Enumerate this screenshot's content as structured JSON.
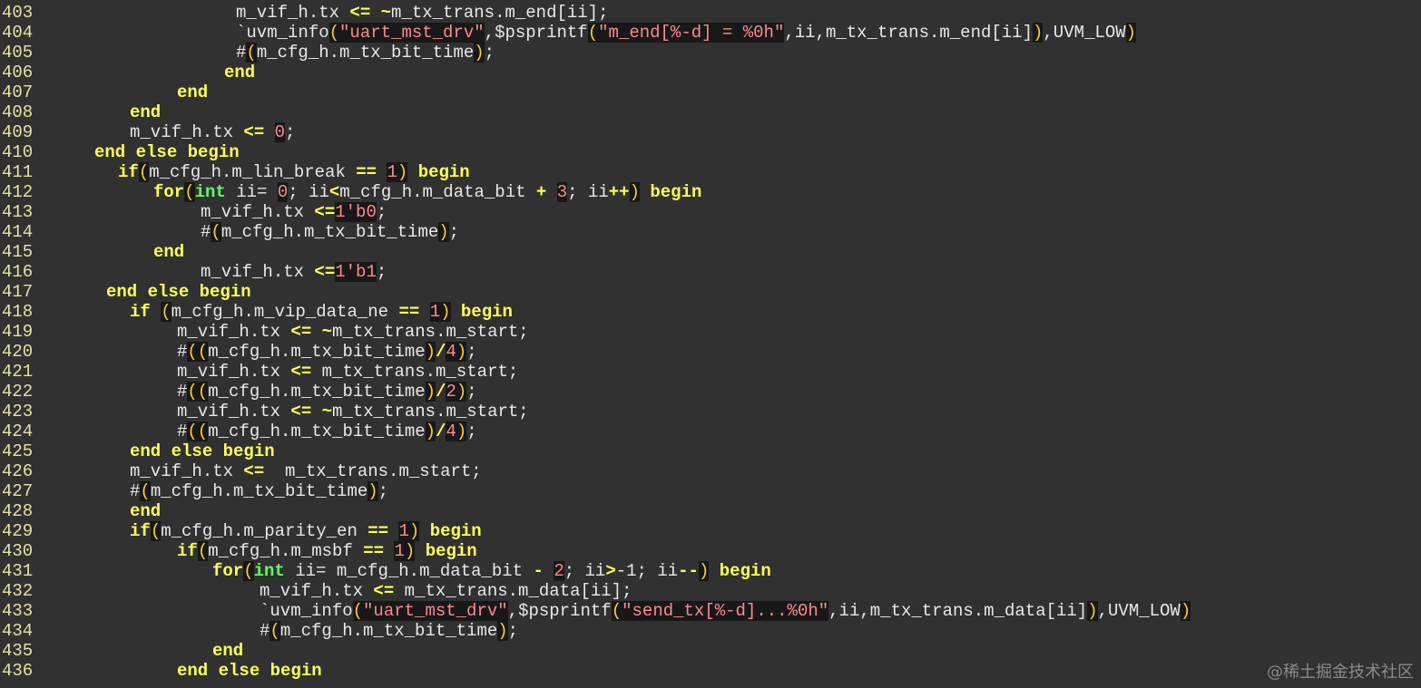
{
  "editor": {
    "lines": [
      {
        "n": "403",
        "indent": 20,
        "tokens": [
          {
            "t": "m_vif_h.tx "
          },
          {
            "t": "<=",
            "c": "opb"
          },
          {
            "t": " "
          },
          {
            "t": "~",
            "c": "opb"
          },
          {
            "t": "m_tx_trans.m_end[ii];"
          }
        ]
      },
      {
        "n": "404",
        "indent": 20,
        "tokens": [
          {
            "t": "`uvm_info"
          },
          {
            "t": "(",
            "c": "par"
          },
          {
            "t": "\"uart_mst_drv\"",
            "c": "str"
          },
          {
            "t": ",$psprintf"
          },
          {
            "t": "(",
            "c": "par"
          },
          {
            "t": "\"m_end[%-d] = %0h\"",
            "c": "str"
          },
          {
            "t": ",ii,m_tx_trans.m_end[ii]"
          },
          {
            "t": ")",
            "c": "par"
          },
          {
            "t": ",UVM_LOW"
          },
          {
            "t": ")",
            "c": "par"
          }
        ]
      },
      {
        "n": "405",
        "indent": 20,
        "tokens": [
          {
            "t": "#"
          },
          {
            "t": "(",
            "c": "par"
          },
          {
            "t": "m_cfg_h.m_tx_bit_time"
          },
          {
            "t": ")",
            "c": "par"
          },
          {
            "t": ";"
          }
        ]
      },
      {
        "n": "406",
        "indent": 19,
        "tokens": [
          {
            "t": "end",
            "c": "kw"
          }
        ]
      },
      {
        "n": "407",
        "indent": 15,
        "tokens": [
          {
            "t": "end",
            "c": "kw"
          }
        ]
      },
      {
        "n": "408",
        "indent": 11,
        "tokens": [
          {
            "t": "end",
            "c": "kw"
          }
        ]
      },
      {
        "n": "409",
        "indent": 11,
        "tokens": [
          {
            "t": "m_vif_h.tx "
          },
          {
            "t": "<=",
            "c": "opb"
          },
          {
            "t": " "
          },
          {
            "t": "0",
            "c": "num"
          },
          {
            "t": ";"
          }
        ]
      },
      {
        "n": "410",
        "indent": 8,
        "tokens": [
          {
            "t": "end else begin",
            "c": "kw"
          }
        ]
      },
      {
        "n": "411",
        "indent": 10,
        "tokens": [
          {
            "t": "if",
            "c": "kw"
          },
          {
            "t": "(",
            "c": "par"
          },
          {
            "t": "m_cfg_h.m_lin_break "
          },
          {
            "t": "==",
            "c": "opb"
          },
          {
            "t": " "
          },
          {
            "t": "1",
            "c": "num"
          },
          {
            "t": ")",
            "c": "par"
          },
          {
            "t": " "
          },
          {
            "t": "begin",
            "c": "kw"
          }
        ]
      },
      {
        "n": "412",
        "indent": 13,
        "tokens": [
          {
            "t": "for",
            "c": "kw"
          },
          {
            "t": "(",
            "c": "par"
          },
          {
            "t": "int",
            "c": "ty"
          },
          {
            "t": " ii= "
          },
          {
            "t": "0",
            "c": "num"
          },
          {
            "t": "; ii"
          },
          {
            "t": "<",
            "c": "opb"
          },
          {
            "t": "m_cfg_h.m_data_bit "
          },
          {
            "t": "+",
            "c": "opb"
          },
          {
            "t": " "
          },
          {
            "t": "3",
            "c": "num"
          },
          {
            "t": "; ii"
          },
          {
            "t": "++",
            "c": "opb"
          },
          {
            "t": ")",
            "c": "par"
          },
          {
            "t": " "
          },
          {
            "t": "begin",
            "c": "kw"
          }
        ]
      },
      {
        "n": "413",
        "indent": 17,
        "tokens": [
          {
            "t": "m_vif_h.tx "
          },
          {
            "t": "<=",
            "c": "opb"
          },
          {
            "t": "1'b0",
            "c": "num"
          },
          {
            "t": ";"
          }
        ]
      },
      {
        "n": "414",
        "indent": 17,
        "tokens": [
          {
            "t": "#"
          },
          {
            "t": "(",
            "c": "par"
          },
          {
            "t": "m_cfg_h.m_tx_bit_time"
          },
          {
            "t": ")",
            "c": "par"
          },
          {
            "t": ";"
          }
        ]
      },
      {
        "n": "415",
        "indent": 13,
        "tokens": [
          {
            "t": "end",
            "c": "kw"
          }
        ]
      },
      {
        "n": "416",
        "indent": 17,
        "tokens": [
          {
            "t": "m_vif_h.tx "
          },
          {
            "t": "<=",
            "c": "opb"
          },
          {
            "t": "1'b1",
            "c": "num"
          },
          {
            "t": ";"
          }
        ]
      },
      {
        "n": "417",
        "indent": 9,
        "tokens": [
          {
            "t": "end else begin",
            "c": "kw"
          }
        ]
      },
      {
        "n": "418",
        "indent": 11,
        "tokens": [
          {
            "t": "if",
            "c": "kw"
          },
          {
            "t": " "
          },
          {
            "t": "(",
            "c": "par"
          },
          {
            "t": "m_cfg_h.m_vip_data_ne "
          },
          {
            "t": "==",
            "c": "opb"
          },
          {
            "t": " "
          },
          {
            "t": "1",
            "c": "num"
          },
          {
            "t": ")",
            "c": "par"
          },
          {
            "t": " "
          },
          {
            "t": "begin",
            "c": "kw"
          }
        ]
      },
      {
        "n": "419",
        "indent": 15,
        "tokens": [
          {
            "t": "m_vif_h.tx "
          },
          {
            "t": "<=",
            "c": "opb"
          },
          {
            "t": " "
          },
          {
            "t": "~",
            "c": "opb"
          },
          {
            "t": "m_tx_trans.m_start;"
          }
        ]
      },
      {
        "n": "420",
        "indent": 15,
        "tokens": [
          {
            "t": "#"
          },
          {
            "t": "((",
            "c": "par"
          },
          {
            "t": "m_cfg_h.m_tx_bit_time"
          },
          {
            "t": ")",
            "c": "par"
          },
          {
            "t": "/",
            "c": "opb"
          },
          {
            "t": "4",
            "c": "num"
          },
          {
            "t": ")",
            "c": "par"
          },
          {
            "t": ";"
          }
        ]
      },
      {
        "n": "421",
        "indent": 15,
        "tokens": [
          {
            "t": "m_vif_h.tx "
          },
          {
            "t": "<=",
            "c": "opb"
          },
          {
            "t": " m_tx_trans.m_start;"
          }
        ]
      },
      {
        "n": "422",
        "indent": 15,
        "tokens": [
          {
            "t": "#"
          },
          {
            "t": "((",
            "c": "par"
          },
          {
            "t": "m_cfg_h.m_tx_bit_time"
          },
          {
            "t": ")",
            "c": "par"
          },
          {
            "t": "/",
            "c": "opb"
          },
          {
            "t": "2",
            "c": "num"
          },
          {
            "t": ")",
            "c": "par"
          },
          {
            "t": ";"
          }
        ]
      },
      {
        "n": "423",
        "indent": 15,
        "tokens": [
          {
            "t": "m_vif_h.tx "
          },
          {
            "t": "<=",
            "c": "opb"
          },
          {
            "t": " "
          },
          {
            "t": "~",
            "c": "opb"
          },
          {
            "t": "m_tx_trans.m_start;"
          }
        ]
      },
      {
        "n": "424",
        "indent": 15,
        "tokens": [
          {
            "t": "#"
          },
          {
            "t": "((",
            "c": "par"
          },
          {
            "t": "m_cfg_h.m_tx_bit_time"
          },
          {
            "t": ")",
            "c": "par"
          },
          {
            "t": "/",
            "c": "opb"
          },
          {
            "t": "4",
            "c": "num"
          },
          {
            "t": ")",
            "c": "par"
          },
          {
            "t": ";"
          }
        ]
      },
      {
        "n": "425",
        "indent": 11,
        "tokens": [
          {
            "t": "end else begin",
            "c": "kw"
          }
        ]
      },
      {
        "n": "426",
        "indent": 11,
        "tokens": [
          {
            "t": "m_vif_h.tx "
          },
          {
            "t": "<=",
            "c": "opb"
          },
          {
            "t": "  m_tx_trans.m_start;"
          }
        ]
      },
      {
        "n": "427",
        "indent": 11,
        "tokens": [
          {
            "t": "#"
          },
          {
            "t": "(",
            "c": "par"
          },
          {
            "t": "m_cfg_h.m_tx_bit_time"
          },
          {
            "t": ")",
            "c": "par"
          },
          {
            "t": ";"
          }
        ]
      },
      {
        "n": "428",
        "indent": 11,
        "tokens": [
          {
            "t": "end",
            "c": "kw"
          }
        ]
      },
      {
        "n": "429",
        "indent": 11,
        "tokens": [
          {
            "t": "if",
            "c": "kw"
          },
          {
            "t": "(",
            "c": "par"
          },
          {
            "t": "m_cfg_h.m_parity_en "
          },
          {
            "t": "==",
            "c": "opb"
          },
          {
            "t": " "
          },
          {
            "t": "1",
            "c": "num"
          },
          {
            "t": ")",
            "c": "par"
          },
          {
            "t": " "
          },
          {
            "t": "begin",
            "c": "kw"
          }
        ]
      },
      {
        "n": "430",
        "indent": 15,
        "tokens": [
          {
            "t": "if",
            "c": "kw"
          },
          {
            "t": "(",
            "c": "par"
          },
          {
            "t": "m_cfg_h.m_msbf "
          },
          {
            "t": "==",
            "c": "opb"
          },
          {
            "t": " "
          },
          {
            "t": "1",
            "c": "num"
          },
          {
            "t": ")",
            "c": "par"
          },
          {
            "t": " "
          },
          {
            "t": "begin",
            "c": "kw"
          }
        ]
      },
      {
        "n": "431",
        "indent": 18,
        "tokens": [
          {
            "t": "for",
            "c": "kw"
          },
          {
            "t": "(",
            "c": "par"
          },
          {
            "t": "int",
            "c": "ty"
          },
          {
            "t": " ii= m_cfg_h.m_data_bit "
          },
          {
            "t": "-",
            "c": "opb"
          },
          {
            "t": " "
          },
          {
            "t": "2",
            "c": "num"
          },
          {
            "t": "; ii"
          },
          {
            "t": ">",
            "c": "opb"
          },
          {
            "t": "-1; ii"
          },
          {
            "t": "--",
            "c": "opb"
          },
          {
            "t": ")",
            "c": "par"
          },
          {
            "t": " "
          },
          {
            "t": "begin",
            "c": "kw"
          }
        ]
      },
      {
        "n": "432",
        "indent": 22,
        "tokens": [
          {
            "t": "m_vif_h.tx "
          },
          {
            "t": "<=",
            "c": "opb"
          },
          {
            "t": " m_tx_trans.m_data[ii];"
          }
        ]
      },
      {
        "n": "433",
        "indent": 22,
        "tokens": [
          {
            "t": "`uvm_info"
          },
          {
            "t": "(",
            "c": "par"
          },
          {
            "t": "\"uart_mst_drv\"",
            "c": "str"
          },
          {
            "t": ",$psprintf"
          },
          {
            "t": "(",
            "c": "par"
          },
          {
            "t": "\"send_tx[%-d]...%0h\"",
            "c": "str"
          },
          {
            "t": ",ii,m_tx_trans.m_data[ii]"
          },
          {
            "t": ")",
            "c": "par"
          },
          {
            "t": ",UVM_LOW"
          },
          {
            "t": ")",
            "c": "par"
          }
        ]
      },
      {
        "n": "434",
        "indent": 22,
        "tokens": [
          {
            "t": "#"
          },
          {
            "t": "(",
            "c": "par"
          },
          {
            "t": "m_cfg_h.m_tx_bit_time"
          },
          {
            "t": ")",
            "c": "par"
          },
          {
            "t": ";"
          }
        ]
      },
      {
        "n": "435",
        "indent": 18,
        "tokens": [
          {
            "t": "end",
            "c": "kw"
          }
        ]
      },
      {
        "n": "436",
        "indent": 15,
        "tokens": [
          {
            "t": "end else begin",
            "c": "kw"
          }
        ]
      }
    ]
  },
  "watermark": "@稀土掘金技术社区"
}
